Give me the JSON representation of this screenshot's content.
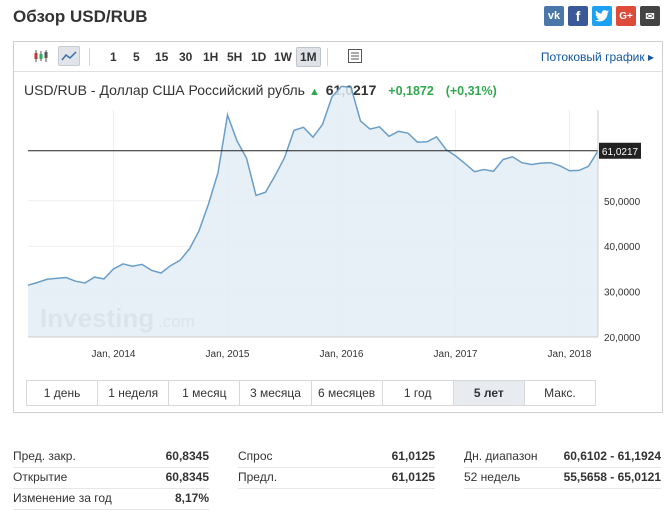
{
  "page_title": "Обзор USD/RUB",
  "share": [
    {
      "label": "vk",
      "icon": "vk-icon"
    },
    {
      "label": "f",
      "icon": "facebook-icon"
    },
    {
      "label": "🐦",
      "icon": "twitter-icon"
    },
    {
      "label": "G+",
      "icon": "google-plus-icon"
    },
    {
      "label": "✉",
      "icon": "email-icon"
    }
  ],
  "toolbar": {
    "timeframes": [
      "1",
      "5",
      "15",
      "30",
      "1H",
      "5H",
      "1D",
      "1W",
      "1M"
    ],
    "active_timeframe": "1M",
    "stream_link": "Потоковый график ▸"
  },
  "quote": {
    "symbol_text": "USD/RUB - Доллар США Российский рубль",
    "arrow": "▲",
    "price": "61,0217",
    "change": "+0,1872",
    "change_pct": "(+0,31%)",
    "up_color": "#31a84f"
  },
  "watermark": {
    "brand": "Investing",
    "suffix": ".com"
  },
  "range_buttons": [
    "1 день",
    "1 неделя",
    "1 месяц",
    "3 месяца",
    "6 месяцев",
    "1 год",
    "5 лет",
    "Макс."
  ],
  "active_range": "5 лет",
  "stats": {
    "col1": [
      {
        "label": "Пред. закр.",
        "value": "60,8345"
      },
      {
        "label": "Открытие",
        "value": "60,8345"
      },
      {
        "label": "Изменение за год",
        "value": "8,17%"
      }
    ],
    "col2": [
      {
        "label": "Спрос",
        "value": "61,0125"
      },
      {
        "label": "Предл.",
        "value": "61,0125"
      }
    ],
    "col3": [
      {
        "label": "Дн. диапазон",
        "value": "60,6102 - 61,1924"
      },
      {
        "label": "52 недель",
        "value": "55,5658 - 65,0121"
      }
    ]
  },
  "chart_data": {
    "type": "area",
    "title": "",
    "xlabel": "",
    "ylabel": "",
    "x_start": "2013-04",
    "x_end": "2018-04",
    "x_ticks": [
      {
        "label": "Jan, 2014",
        "x": "2014-01"
      },
      {
        "label": "Jan, 2015",
        "x": "2015-01"
      },
      {
        "label": "Jan, 2016",
        "x": "2016-01"
      },
      {
        "label": "Jan, 2017",
        "x": "2017-01"
      },
      {
        "label": "Jan, 2018",
        "x": "2018-01"
      }
    ],
    "ylim": [
      20,
      70
    ],
    "y_ticks": [
      "20,0000",
      "30,0000",
      "40,0000",
      "50,0000"
    ],
    "y_tick_values": [
      20,
      30,
      40,
      50
    ],
    "current_value": 61.0217,
    "current_label": "61,0217",
    "line_color": "#6a9ec8",
    "fill_color": "#e3edf5",
    "series": [
      {
        "x": [
          "2013-04",
          "2013-05",
          "2013-06",
          "2013-07",
          "2013-08",
          "2013-09",
          "2013-10",
          "2013-11",
          "2013-12",
          "2014-01",
          "2014-02",
          "2014-03",
          "2014-04",
          "2014-05",
          "2014-06",
          "2014-07",
          "2014-08",
          "2014-09",
          "2014-10",
          "2014-11",
          "2014-12",
          "2015-01",
          "2015-02",
          "2015-03",
          "2015-04",
          "2015-05",
          "2015-06",
          "2015-07",
          "2015-08",
          "2015-09",
          "2015-10",
          "2015-11",
          "2015-12",
          "2016-01",
          "2016-02",
          "2016-03",
          "2016-04",
          "2016-05",
          "2016-06",
          "2016-07",
          "2016-08",
          "2016-09",
          "2016-10",
          "2016-11",
          "2016-12",
          "2017-01",
          "2017-02",
          "2017-03",
          "2017-04",
          "2017-05",
          "2017-06",
          "2017-07",
          "2017-08",
          "2017-09",
          "2017-10",
          "2017-11",
          "2017-12",
          "2018-01",
          "2018-02",
          "2018-03",
          "2018-04"
        ],
        "values": [
          31.4,
          32.0,
          32.7,
          32.9,
          33.1,
          32.3,
          31.9,
          33.2,
          32.8,
          35.0,
          36.1,
          35.6,
          36.0,
          34.7,
          34.1,
          35.7,
          36.9,
          39.4,
          43.4,
          49.3,
          56.2,
          68.9,
          63.2,
          59.4,
          51.2,
          51.9,
          55.5,
          59.5,
          65.5,
          66.2,
          64.0,
          66.8,
          72.9,
          75.2,
          75.0,
          67.6,
          65.8,
          66.3,
          64.2,
          65.3,
          64.9,
          62.9,
          63.0,
          64.1,
          61.3,
          59.9,
          58.2,
          56.4,
          56.9,
          56.5,
          59.1,
          59.7,
          58.4,
          58.0,
          58.3,
          58.4,
          57.7,
          56.6,
          56.7,
          57.6,
          61.0
        ]
      }
    ]
  }
}
